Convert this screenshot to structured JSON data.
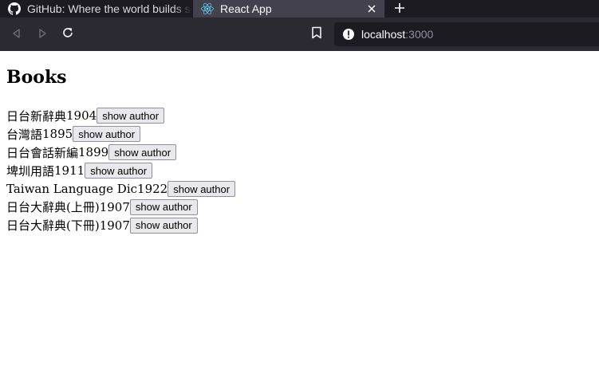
{
  "browser": {
    "tabs": [
      {
        "title": "GitHub: Where the world builds software",
        "icon": "github-icon",
        "active": false
      },
      {
        "title": "React App",
        "icon": "react-icon",
        "active": true
      }
    ],
    "url_host": "localhost",
    "url_port": ":3000"
  },
  "page": {
    "heading": "Books",
    "button_label": "show author",
    "books": [
      {
        "title": "日台新辭典",
        "year": "1904"
      },
      {
        "title": "台灣語",
        "year": "1895"
      },
      {
        "title": "日台會話新編",
        "year": "1899"
      },
      {
        "title": "埤圳用語",
        "year": "1911"
      },
      {
        "title": "Taiwan Language Dic",
        "year": "1922"
      },
      {
        "title": "日台大辭典(上冊)",
        "year": "1907"
      },
      {
        "title": "日台大辭典(下冊)",
        "year": "1907"
      }
    ]
  },
  "colors": {
    "tabstrip_bg": "#1c1b22",
    "active_tab_bg": "#42414d",
    "navbar_bg": "#2b2a33",
    "urlbar_bg": "#1c1b22"
  }
}
